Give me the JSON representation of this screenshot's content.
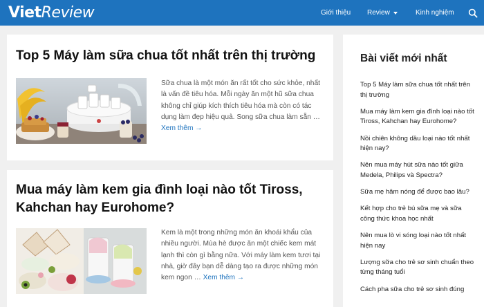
{
  "header": {
    "logo_main": "Viet",
    "logo_accent": "Review",
    "nav": [
      {
        "label": "Giới thiệu"
      },
      {
        "label": "Review"
      },
      {
        "label": "Kinh nghiệm"
      }
    ]
  },
  "posts": [
    {
      "title": "Top 5 Máy làm sữa chua tốt nhất trên thị trường",
      "excerpt": "Sữa chua là một món ăn rất tốt cho sức khỏe, nhất là vấn đề tiêu hóa. Mỗi ngày ăn một hũ sữa chua không chỉ giúp kích thích tiêu hóa mà còn có tác dụng làm đẹp hiệu quả. Song sữa chua làm sẵn …",
      "more": "Xem thêm →"
    },
    {
      "title": "Mua máy làm kem gia đình loại nào tốt Tiross, Kahchan hay Eurohome?",
      "excerpt": "Kem là một trong những món ăn khoái khẩu của nhiều người. Mùa hè được ăn một chiếc kem mát lạnh thì còn gì bằng nữa. Với máy làm kem tươi tại nhà, giờ đây bạn dễ dàng tạo ra được những món kem ngon …",
      "more": "Xem thêm →"
    }
  ],
  "sidebar": {
    "title": "Bài viết mới nhất",
    "items": [
      "Top 5 Máy làm sữa chua tốt nhất trên thị trường",
      "Mua máy làm kem gia đình loại nào tốt Tiross, Kahchan hay Eurohome?",
      "Nồi chiên không dầu loại nào tốt nhất hiện nay?",
      "Nên mua máy hút sữa nào tốt giữa Medela, Philips và Spectra?",
      "Sữa mẹ hâm nóng để được bao lâu?",
      "Kết hợp cho trẻ bú sữa mẹ và sữa công thức khoa học nhất",
      "Nên mua lò vi sóng loại nào tốt nhất hiện nay",
      "Lượng sữa cho trẻ sơ sinh chuẩn theo từng tháng tuổi",
      "Cách pha sữa cho trẻ sơ sinh đúng"
    ]
  }
}
